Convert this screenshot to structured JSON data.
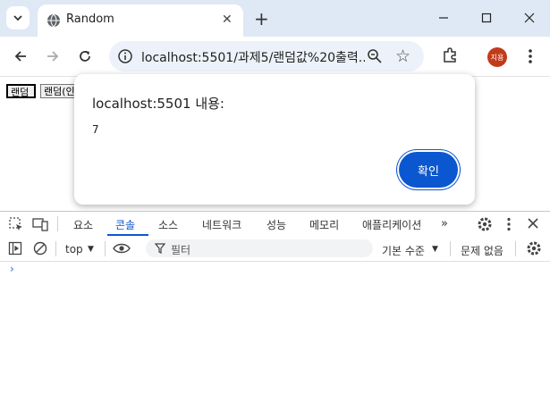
{
  "browser": {
    "tab_title": "Random",
    "url": "localhost:5501/과제5/랜덤값%20출력...",
    "profile_initials": "지용"
  },
  "page": {
    "buttons": [
      "랜덤",
      "랜덤(인"
    ]
  },
  "dialog": {
    "heading": "localhost:5501 내용:",
    "message": "7",
    "ok_label": "확인"
  },
  "devtools": {
    "tabs": [
      {
        "label": "요소"
      },
      {
        "label": "콘솔"
      },
      {
        "label": "소스"
      },
      {
        "label": "네트워크"
      },
      {
        "label": "성능"
      },
      {
        "label": "메모리"
      },
      {
        "label": "애플리케이션"
      }
    ],
    "active_tab": "콘솔",
    "context": "top",
    "filter_placeholder": "필터",
    "log_level": "기본 수준",
    "issues": "문제 없음",
    "prompt": "›"
  },
  "colors": {
    "accent": "#0b57d0",
    "titlebar": "#dfe8f5",
    "avatar": "#c13b1b"
  }
}
